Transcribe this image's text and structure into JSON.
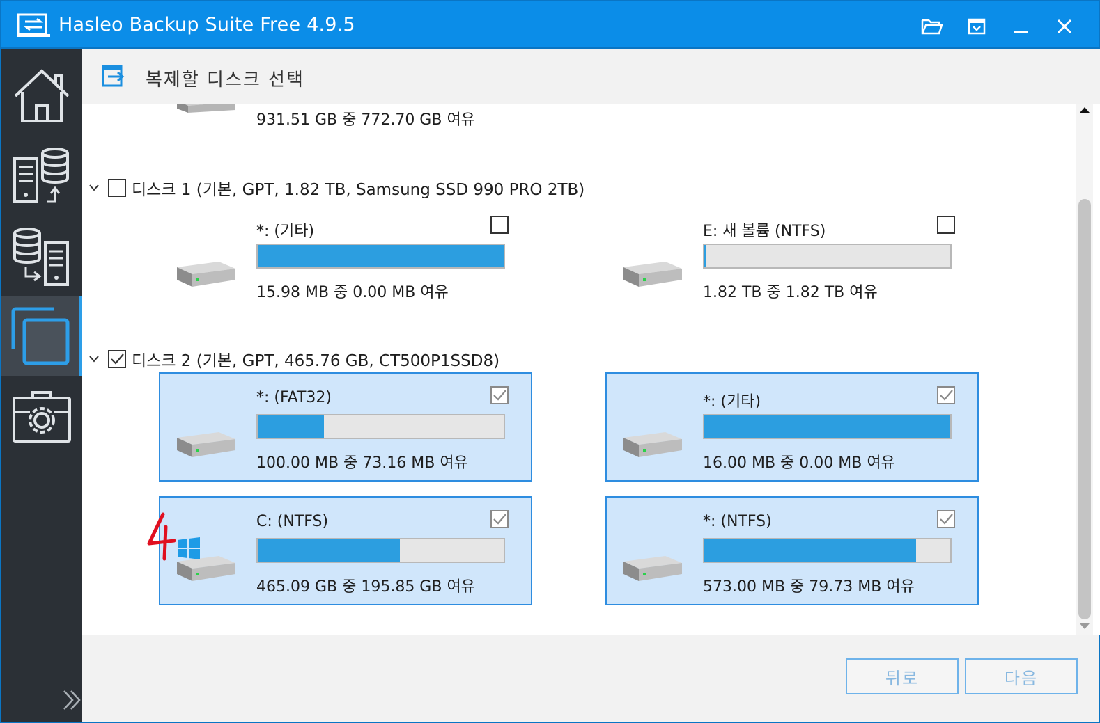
{
  "app": {
    "title": "Hasleo Backup Suite Free 4.9.5"
  },
  "titlebar_buttons": [
    "folder-open-icon",
    "restore-icon",
    "minimize-icon",
    "close-icon"
  ],
  "sidebar": {
    "items": [
      {
        "name": "home",
        "icon": "home-icon",
        "active": false
      },
      {
        "name": "backup",
        "icon": "backup-icon",
        "active": false
      },
      {
        "name": "restore",
        "icon": "restore-data-icon",
        "active": false
      },
      {
        "name": "clone",
        "icon": "clone-icon",
        "active": true
      },
      {
        "name": "tools",
        "icon": "toolbox-icon",
        "active": false
      }
    ]
  },
  "header": {
    "title": "복제할 디스크 선택"
  },
  "disk0_partial": {
    "info": "931.51 GB 중 772.70 GB 여유"
  },
  "disks": [
    {
      "label": "디스크 1 (기본, GPT, 1.82 TB,  Samsung SSD 990 PRO 2TB)",
      "checked": false,
      "partitions": [
        {
          "name": "*: (기타)",
          "info": "15.98 MB 중 0.00 MB 여유",
          "used_fraction": 1.0,
          "checked": false,
          "selected": false
        },
        {
          "name": "E: 새 볼륨 (NTFS)",
          "info": "1.82 TB 중 1.82 TB 여유",
          "used_fraction": 0.005,
          "checked": false,
          "selected": false
        }
      ]
    },
    {
      "label": "디스크 2 (기본, GPT, 465.76 GB,  CT500P1SSD8)",
      "checked": true,
      "partitions": [
        {
          "name": "*: (FAT32)",
          "info": "100.00 MB 중 73.16 MB 여유",
          "used_fraction": 0.268,
          "checked": true,
          "selected": true
        },
        {
          "name": "*: (기타)",
          "info": "16.00 MB 중 0.00 MB 여유",
          "used_fraction": 1.0,
          "checked": true,
          "selected": true
        },
        {
          "name": "C: (NTFS)",
          "info": "465.09 GB 중 195.85 GB 여유",
          "used_fraction": 0.579,
          "checked": true,
          "selected": true,
          "system": true
        },
        {
          "name": "*: (NTFS)",
          "info": "573.00 MB 중 79.73 MB 여유",
          "used_fraction": 0.861,
          "checked": true,
          "selected": true
        }
      ]
    }
  ],
  "footer": {
    "back_label": "뒤로",
    "next_label": "다음"
  },
  "colors": {
    "accent": "#0b8de8",
    "sidebar": "#2b3036",
    "selected_bg": "#d0e6fb",
    "bar_fill": "#2c9ee0",
    "annotation": "#e01020"
  }
}
